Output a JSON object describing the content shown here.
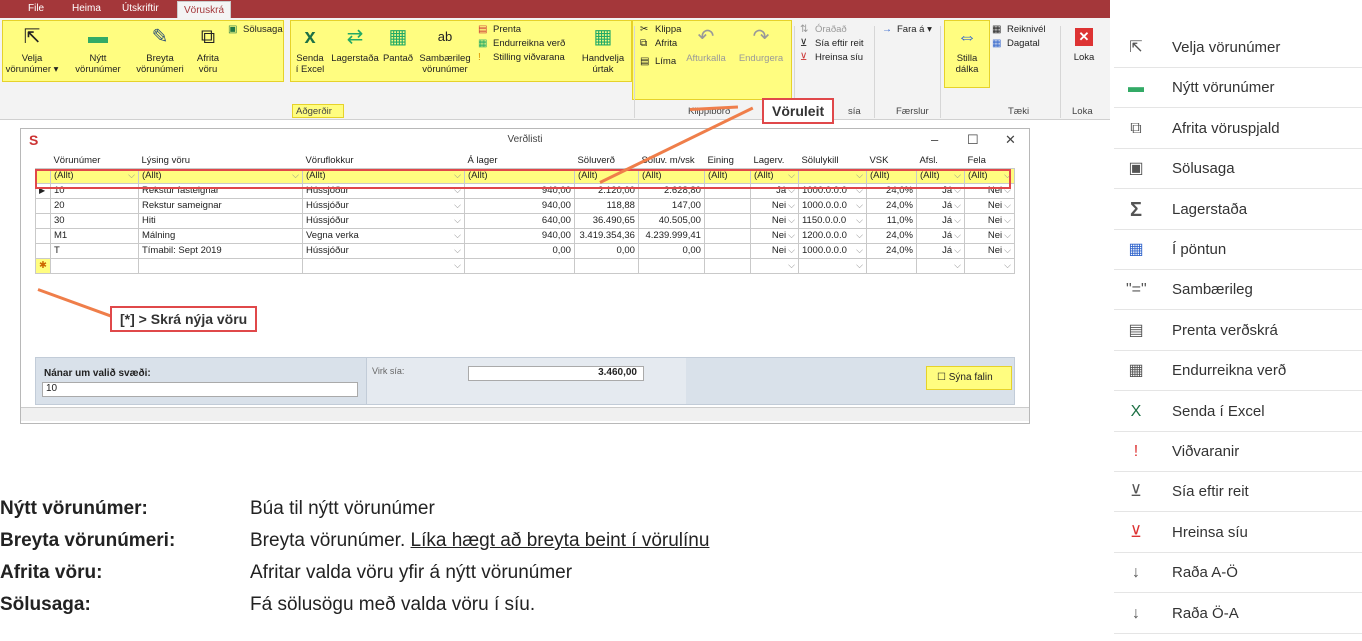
{
  "tabs": [
    {
      "label": "File"
    },
    {
      "label": "Heima"
    },
    {
      "label": "Útskriftir"
    },
    {
      "label": "Vöruskrá"
    }
  ],
  "ribbon": {
    "velja": "Velja",
    "velja2": "vörunúmer",
    "nytt": "Nýtt",
    "nytt2": "vörunúmer",
    "breyta": "Breyta",
    "breyta2": "vörunúmeri",
    "afrita": "Afrita",
    "afrita2": "vöru",
    "solusaga": "Sölusaga",
    "senda": "Senda",
    "senda2": "í Excel",
    "lagerstada": "Lagerstaða",
    "pantad": "Pantað",
    "sambaerileg": "Sambærileg",
    "sambaerileg2": "vörunúmer",
    "prenta": "Prenta",
    "endurreikna": "Endurreikna verð",
    "stilling": "Stilling viðvarana",
    "handvelja": "Handvelja",
    "handvelja2": "úrtak",
    "adgerdir": "Aðgerðir",
    "klippa": "Klippa",
    "afrita_s": "Afrita",
    "lima": "Líma",
    "afturkalla": "Afturkalla",
    "endurgera": "Endurgera",
    "klippibord": "Klippiborð",
    "oradad": "Óraðað",
    "sia_eftir": "Sía eftir reit",
    "hreinsa": "Hreinsa síu",
    "sia": "sía",
    "fara": "Fara á",
    "faerslur": "Færslur",
    "stilla": "Stilla",
    "stilla2": "dálka",
    "reiknivel": "Reiknivél",
    "dagatal": "Dagatal",
    "taeki": "Tæki",
    "loka": "Loka",
    "loka_g": "Loka"
  },
  "window": {
    "title": "Verðlisti"
  },
  "grid": {
    "headers": [
      "Vörunúmer",
      "Lýsing vöru",
      "Vöruflokkur",
      "Á lager",
      "Söluverð",
      "Söluv. m/vsk",
      "Eining",
      "Lagerv.",
      "Sölulykill",
      "VSK",
      "Afsl.",
      "Fela"
    ],
    "filter": "(Allt)",
    "rows": [
      [
        "10",
        "Rekstur fasteignar",
        "Hússjóður",
        "940,00",
        "2.120,00",
        "2.628,80",
        "",
        "Já",
        "1000.0.0.0",
        "24,0%",
        "Já",
        "Nei"
      ],
      [
        "20",
        "Rekstur sameignar",
        "Hússjóður",
        "940,00",
        "118,88",
        "147,00",
        "",
        "Nei",
        "1000.0.0.0",
        "24,0%",
        "Já",
        "Nei"
      ],
      [
        "30",
        "Hiti",
        "Hússjóður",
        "640,00",
        "36.490,65",
        "40.505,00",
        "",
        "Nei",
        "1150.0.0.0",
        "11,0%",
        "Já",
        "Nei"
      ],
      [
        "M1",
        "Málning",
        "Vegna verka",
        "940,00",
        "3.419.354,36",
        "4.239.999,41",
        "",
        "Nei",
        "1200.0.0.0",
        "24,0%",
        "Já",
        "Nei"
      ],
      [
        "T",
        "Tímabil: Sept 2019",
        "Hússjóður",
        "0,00",
        "0,00",
        "0,00",
        "",
        "Nei",
        "1000.0.0.0",
        "24,0%",
        "Já",
        "Nei"
      ]
    ]
  },
  "details": {
    "label": "Nánar um valið svæði:",
    "value": "10",
    "virk_label": "Virk sía:",
    "virk_value": "3.460,00",
    "syna_falin": "Sýna falin"
  },
  "callouts": {
    "voruleit": "Vöruleit",
    "skra": "[*] > Skrá nýja vöru"
  },
  "doc": [
    {
      "term": "Nýtt vörunúmer:",
      "desc": "Búa til nýtt vörunúmer",
      "link": ""
    },
    {
      "term": "Breyta vörunúmeri:",
      "desc": "Breyta vörunúmer. ",
      "link": "Líka hægt að breyta beint í vörulínu"
    },
    {
      "term": "Afrita vöru:",
      "desc": "Afritar valda vöru yfir á nýtt vörunúmer",
      "link": ""
    },
    {
      "term": "Sölusaga:",
      "desc": "Fá sölusögu með valda vöru í síu.",
      "link": ""
    }
  ],
  "menu": [
    {
      "label": "Velja vörunúmer",
      "icon": "cursor-icon"
    },
    {
      "label": "Nýtt vörunúmer",
      "icon": "new-icon"
    },
    {
      "label": "Afrita vöruspjald",
      "icon": "copy-icon"
    },
    {
      "label": "Sölusaga",
      "icon": "history-icon"
    },
    {
      "label": "Lagerstaða",
      "icon": "sigma-icon"
    },
    {
      "label": "Í pöntun",
      "icon": "calendar-icon"
    },
    {
      "label": "Sambærileg",
      "icon": "equal-icon"
    },
    {
      "label": "Prenta verðskrá",
      "icon": "print-icon"
    },
    {
      "label": "Endurreikna verð",
      "icon": "calculator-icon"
    },
    {
      "label": "Senda í Excel",
      "icon": "excel-icon"
    },
    {
      "label": "Viðvaranir",
      "icon": "alert-icon"
    },
    {
      "label": "Sía eftir reit",
      "icon": "filter-icon"
    },
    {
      "label": "Hreinsa síu",
      "icon": "clear-filter-icon"
    },
    {
      "label": "Raða A-Ö",
      "icon": "sort-asc-icon"
    },
    {
      "label": "Raða Ö-A",
      "icon": "sort-desc-icon"
    }
  ]
}
